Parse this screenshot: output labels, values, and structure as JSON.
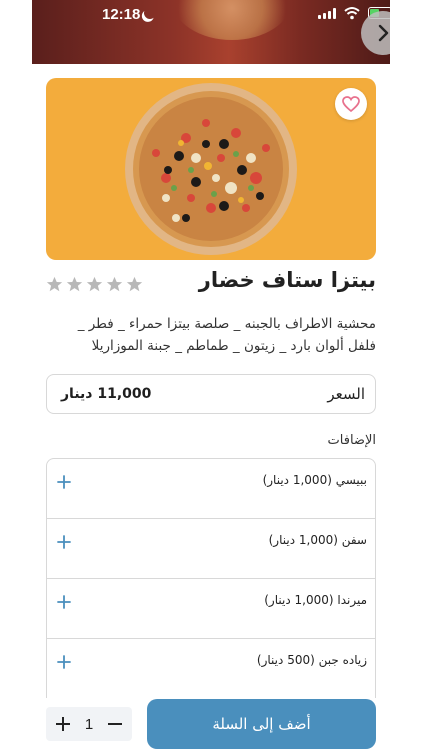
{
  "status_bar": {
    "time": "12:18"
  },
  "product": {
    "title": "بيتزا ستاف خضار",
    "description": "محشية الاطراف بالجبنه _ صلصة بيتزا حمراء _ فطر _ فلفل ألوان بارد _ زيتون _ طماطم _ جبنة الموزاريلا",
    "rating": 0,
    "rating_max": 5
  },
  "price": {
    "label": "السعر",
    "value": "11,000 دينار"
  },
  "addons": {
    "heading": "الإضافات",
    "items": [
      {
        "label": "ببيسي (1,000 دينار)"
      },
      {
        "label": "سفن (1,000 دينار)"
      },
      {
        "label": "ميرندا (1,000 دينار)"
      },
      {
        "label": "زياده جبن (500 دينار)"
      }
    ]
  },
  "cart": {
    "quantity": "1",
    "add_label": "أضف إلى السلة"
  },
  "colors": {
    "accent": "#4a8fbd",
    "image_bg": "#f3ac3c",
    "star": "#b8b8b8",
    "heart": "#e8718d"
  },
  "icons": {
    "back": "chevron-right-icon",
    "favorite": "heart-icon",
    "add": "plus-icon",
    "star": "star-icon"
  }
}
